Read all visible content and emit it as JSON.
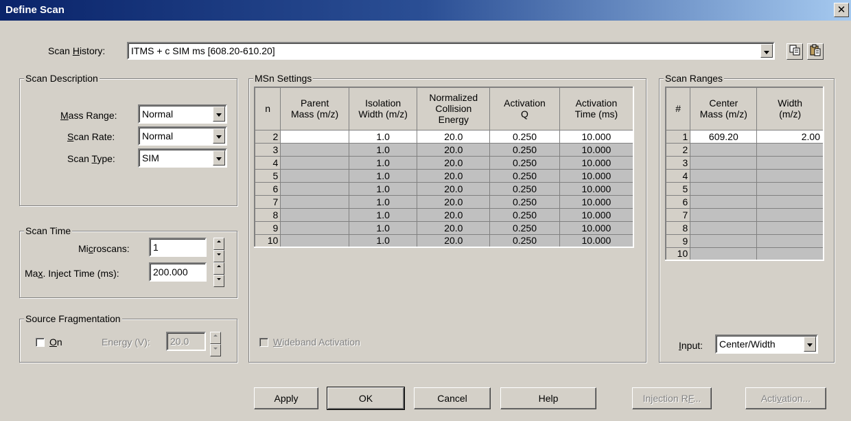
{
  "window": {
    "title": "Define Scan",
    "close_glyph": "✕"
  },
  "scan_history": {
    "label_pre": "Scan ",
    "label_key": "H",
    "label_post": "istory:",
    "value": "ITMS + c SIM ms [608.20-610.20]",
    "copy_icon": "copy-icon",
    "paste_icon": "paste-icon"
  },
  "scan_description": {
    "title": "Scan Description",
    "mass_range": {
      "label_key": "M",
      "label_post": "ass Range:",
      "value": "Normal"
    },
    "scan_rate": {
      "label_key": "S",
      "label_post": "can Rate:",
      "value": "Normal"
    },
    "scan_type": {
      "label_pre": "Scan ",
      "label_key": "T",
      "label_post": "ype:",
      "value": "SIM"
    }
  },
  "scan_time": {
    "title": "Scan Time",
    "microscans": {
      "label_pre": "Mi",
      "label_key": "c",
      "label_post": "roscans:",
      "value": "1"
    },
    "max_inject": {
      "label_pre": "Ma",
      "label_key": "x",
      "label_post": ". Inject Time (ms):",
      "value": "200.000"
    }
  },
  "source_fragmentation": {
    "title": "Source Fragmentation",
    "on_key": "O",
    "on_post": "n",
    "on_checked": false,
    "energy_label": "Energy (V):",
    "energy_value": "20.0"
  },
  "msn_settings": {
    "title": "MSn Settings",
    "headers": [
      "n",
      "Parent\nMass (m/z)",
      "Isolation\nWidth (m/z)",
      "Normalized\nCollision\nEnergy",
      "Activation\nQ",
      "Activation\nTime (ms)"
    ],
    "rows": [
      {
        "n": "2",
        "parent": "",
        "isolation": "1.0",
        "energy": "20.0",
        "q": "0.250",
        "time": "10.000"
      },
      {
        "n": "3",
        "parent": "",
        "isolation": "1.0",
        "energy": "20.0",
        "q": "0.250",
        "time": "10.000"
      },
      {
        "n": "4",
        "parent": "",
        "isolation": "1.0",
        "energy": "20.0",
        "q": "0.250",
        "time": "10.000"
      },
      {
        "n": "5",
        "parent": "",
        "isolation": "1.0",
        "energy": "20.0",
        "q": "0.250",
        "time": "10.000"
      },
      {
        "n": "6",
        "parent": "",
        "isolation": "1.0",
        "energy": "20.0",
        "q": "0.250",
        "time": "10.000"
      },
      {
        "n": "7",
        "parent": "",
        "isolation": "1.0",
        "energy": "20.0",
        "q": "0.250",
        "time": "10.000"
      },
      {
        "n": "8",
        "parent": "",
        "isolation": "1.0",
        "energy": "20.0",
        "q": "0.250",
        "time": "10.000"
      },
      {
        "n": "9",
        "parent": "",
        "isolation": "1.0",
        "energy": "20.0",
        "q": "0.250",
        "time": "10.000"
      },
      {
        "n": "10",
        "parent": "",
        "isolation": "1.0",
        "energy": "20.0",
        "q": "0.250",
        "time": "10.000"
      }
    ],
    "wideband_key": "W",
    "wideband_post": "ideband Activation",
    "wideband_checked": false
  },
  "scan_ranges": {
    "title": "Scan Ranges",
    "headers": [
      "#",
      "Center\nMass (m/z)",
      "Width\n(m/z)"
    ],
    "rows": [
      {
        "n": "1",
        "center": "609.20",
        "width": "2.00"
      },
      {
        "n": "2",
        "center": "",
        "width": ""
      },
      {
        "n": "3",
        "center": "",
        "width": ""
      },
      {
        "n": "4",
        "center": "",
        "width": ""
      },
      {
        "n": "5",
        "center": "",
        "width": ""
      },
      {
        "n": "6",
        "center": "",
        "width": ""
      },
      {
        "n": "7",
        "center": "",
        "width": ""
      },
      {
        "n": "8",
        "center": "",
        "width": ""
      },
      {
        "n": "9",
        "center": "",
        "width": ""
      },
      {
        "n": "10",
        "center": "",
        "width": ""
      }
    ],
    "input_key": "I",
    "input_post": "nput:",
    "input_value": "Center/Width"
  },
  "buttons": {
    "apply": "Apply",
    "ok": "OK",
    "cancel": "Cancel",
    "help": "Help",
    "injection_pre": "Injection R",
    "injection_key": "F",
    "injection_post": "...",
    "activation_pre": "Acti",
    "activation_key": "v",
    "activation_post": "ation..."
  }
}
